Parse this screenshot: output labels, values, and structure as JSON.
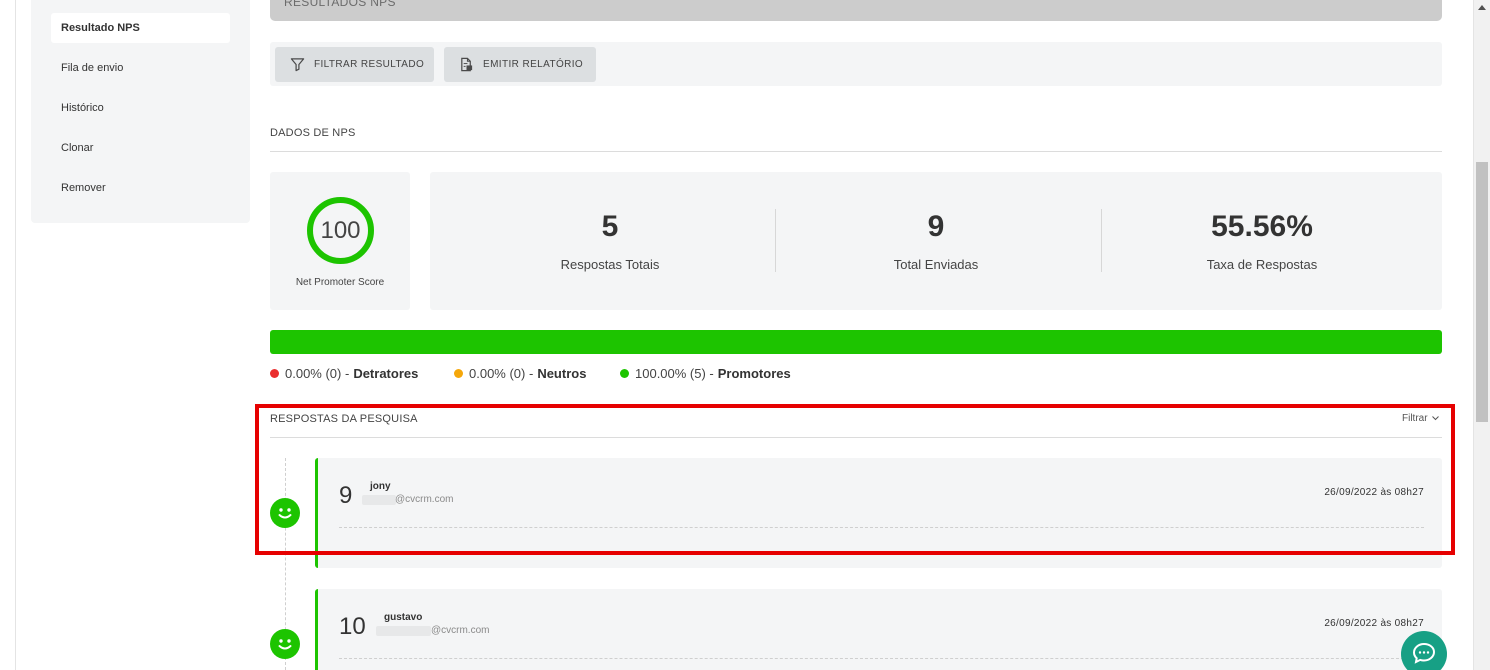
{
  "sidebar": {
    "items": [
      {
        "label": "Resultado NPS",
        "active": true
      },
      {
        "label": "Fila de envio"
      },
      {
        "label": "Histórico"
      },
      {
        "label": "Clonar"
      },
      {
        "label": "Remover"
      }
    ]
  },
  "banner": {
    "title": "RESULTADOS NPS"
  },
  "toolbar": {
    "filter_label": "FILTRAR RESULTADO",
    "report_label": "EMITIR RELATÓRIO"
  },
  "nps_section": {
    "title": "DADOS DE NPS"
  },
  "nps": {
    "score": "100",
    "label": "Net Promoter Score"
  },
  "stats": [
    {
      "value": "5",
      "label": "Respostas Totais"
    },
    {
      "value": "9",
      "label": "Total Enviadas"
    },
    {
      "value": "55.56%",
      "label": "Taxa de Respostas"
    }
  ],
  "progress": {
    "promoters_fraction": 1.0,
    "color": "#1dc400"
  },
  "legend": [
    {
      "value": "0.00% (0) -",
      "label": "Detratores",
      "color": "#ea2e2e"
    },
    {
      "value": "0.00% (0) -",
      "label": "Neutros",
      "color": "#f5a70a"
    },
    {
      "value": "100.00% (5) -",
      "label": "Promotores",
      "color": "#1dc400"
    }
  ],
  "responses_section": {
    "title": "RESPOSTAS DA PESQUISA",
    "filter_label": "Filtrar"
  },
  "responses": [
    {
      "score": "9",
      "name": "jony",
      "email": "@cvcrm.com",
      "date": "26/09/2022 às 08h27",
      "icon": "smile-icon"
    },
    {
      "score": "10",
      "name": "gustavo",
      "email": "@cvcrm.com",
      "date": "26/09/2022 às 08h27",
      "icon": "smile-icon"
    }
  ],
  "colors": {
    "accent": "#1dc400",
    "highlight": "#e60000",
    "chat": "#17a085"
  }
}
